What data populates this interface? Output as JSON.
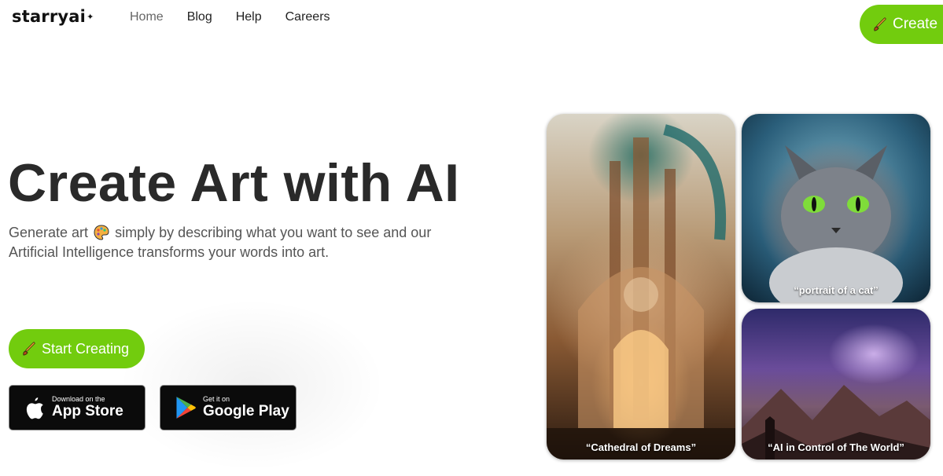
{
  "header": {
    "logo": "starryai",
    "logo_mark": "✦",
    "nav": [
      "Home",
      "Blog",
      "Help",
      "Careers"
    ],
    "create_label": "Create"
  },
  "hero": {
    "title": "Create Art with AI",
    "subtitle_before": "Generate art",
    "subtitle_after": "simply by describing what you want to see and our Artificial Intelligence transforms your words into art.",
    "start_label": "Start Creating"
  },
  "stores": {
    "apple": {
      "small": "Download on the",
      "big": "App Store"
    },
    "google": {
      "small": "Get it on",
      "big": "Google Play"
    }
  },
  "gallery": [
    {
      "caption": "“Cathedral of Dreams”"
    },
    {
      "caption": "“portrait of a cat”"
    },
    {
      "caption": "“AI in Control of The World”"
    }
  ],
  "colors": {
    "accent": "#72cc0e",
    "text": "#2a2a2a"
  }
}
